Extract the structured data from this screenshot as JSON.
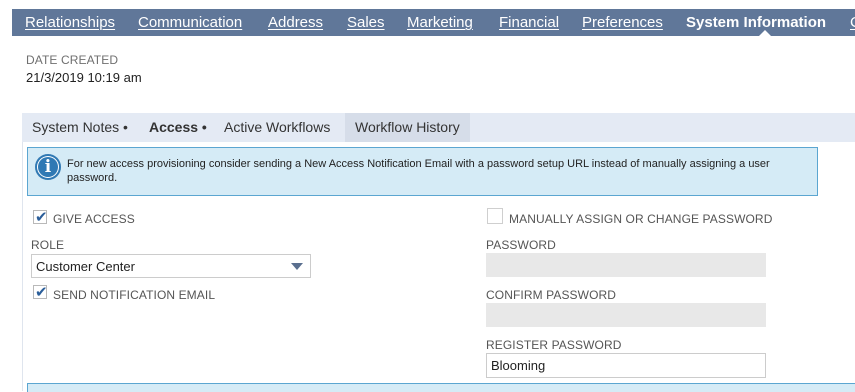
{
  "top_tabs": [
    {
      "label": "Relationships",
      "active": false
    },
    {
      "label": "Communication",
      "active": false
    },
    {
      "label": "Address",
      "active": false
    },
    {
      "label": "Sales",
      "active": false
    },
    {
      "label": "Marketing",
      "active": false
    },
    {
      "label": "Financial",
      "active": false
    },
    {
      "label": "Preferences",
      "active": false
    },
    {
      "label": "System Information",
      "active": true
    },
    {
      "label": "C",
      "active": false
    }
  ],
  "date_created": {
    "label": "DATE CREATED",
    "value": "21/3/2019 10:19 am"
  },
  "subtabs": [
    {
      "label": "System Notes •",
      "active": false
    },
    {
      "label": "Access •",
      "active": true
    },
    {
      "label": "Active Workflows",
      "active": false
    },
    {
      "label": "Workflow History",
      "active": false
    }
  ],
  "info": {
    "icon": "info-icon",
    "text": "For new access provisioning consider sending a New Access Notification Email with a password setup URL instead of manually assigning a user password."
  },
  "access": {
    "give_access": {
      "label": "GIVE ACCESS",
      "checked": true
    },
    "role": {
      "label": "ROLE",
      "value": "Customer Center"
    },
    "send_notification": {
      "label": "SEND NOTIFICATION EMAIL",
      "checked": true
    },
    "manually_assign": {
      "label": "MANUALLY ASSIGN OR CHANGE PASSWORD",
      "checked": false
    },
    "password": {
      "label": "PASSWORD",
      "value": ""
    },
    "confirm_password": {
      "label": "CONFIRM PASSWORD",
      "value": ""
    },
    "register_password": {
      "label": "REGISTER PASSWORD",
      "value": "Blooming"
    }
  },
  "colors": {
    "tab_bar": "#607799",
    "info_bg": "#d5ebf6",
    "info_border": "#5ba6d1",
    "check": "#2b5e9a"
  }
}
